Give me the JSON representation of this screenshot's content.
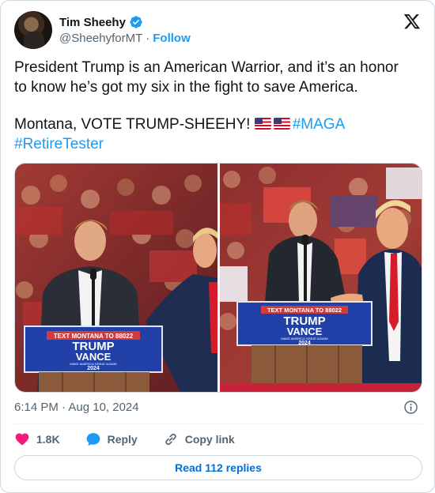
{
  "author": {
    "name": "Tim Sheehy",
    "handle": "@SheehyforMT",
    "separator": "·",
    "follow_label": "Follow"
  },
  "tweet": {
    "line1": "President Trump is an American Warrior, and it’s an honor",
    "line2": "to know he’s got my six in the fight to save America.",
    "line3_prefix": "Montana, VOTE TRUMP-SHEEHY!",
    "hashtag1": "#MAGA",
    "hashtag2": "#RetireTester",
    "timestamp": "6:14 PM · Aug 10, 2024"
  },
  "images": {
    "left": {
      "sign_banner": "TEXT MONTANA TO 88022",
      "sign_line1": "TRUMP",
      "sign_line2": "VANCE",
      "sign_small": "MAKE AMERICA GREAT AGAIN!",
      "sign_year": "2024"
    },
    "right": {
      "sign_banner": "TEXT MONTANA TO 88022",
      "sign_line1": "TRUMP",
      "sign_line2": "VANCE",
      "sign_small": "MAKE AMERICA GREAT AGAIN!",
      "sign_year": "2024"
    }
  },
  "actions": {
    "likes": "1.8K",
    "reply_label": "Reply",
    "copy_label": "Copy link"
  },
  "read_replies_label": "Read 112 replies",
  "colors": {
    "accent": "#1d9bf0",
    "like": "#f91880",
    "secondary_text": "#536471",
    "sign_blue": "#1f4fb0",
    "border": "#cfd9de"
  },
  "icons": [
    "verified-badge-icon",
    "x-logo-icon",
    "us-flag-icon",
    "info-icon",
    "heart-icon",
    "reply-bubble-icon",
    "link-icon"
  ]
}
